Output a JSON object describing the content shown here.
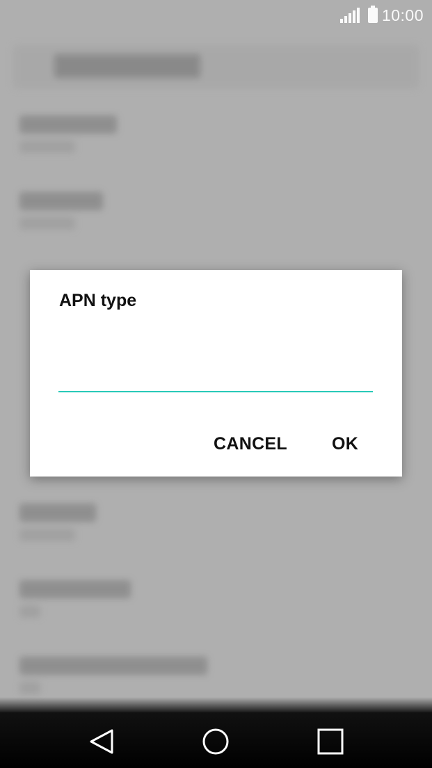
{
  "status_bar": {
    "time": "10:00",
    "icons": [
      "signal-icon",
      "battery-icon"
    ]
  },
  "dialog": {
    "title": "APN type",
    "input_value": "",
    "cancel_label": "CANCEL",
    "ok_label": "OK",
    "accent_color": "#29c9b8"
  },
  "nav_bar": {
    "icons": [
      "back-icon",
      "home-icon",
      "recent-apps-icon"
    ]
  }
}
